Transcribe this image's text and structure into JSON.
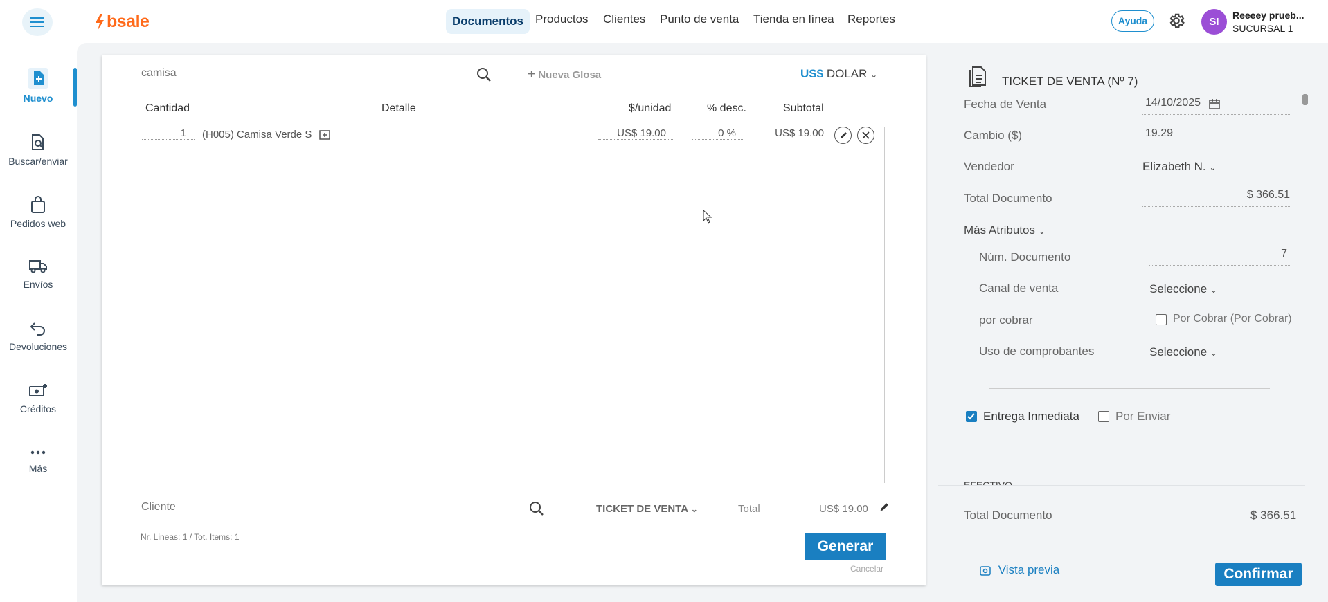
{
  "topbar": {
    "logo": "bsale",
    "nav": [
      "Documentos",
      "Productos",
      "Clientes",
      "Punto de venta",
      "Tienda en línea",
      "Reportes"
    ],
    "help": "Ayuda",
    "avatar_initials": "SI",
    "user_name": "Reeeey prueb...",
    "user_branch": "SUCURSAL 1"
  },
  "sidebar": {
    "items": [
      {
        "label": "Nuevo",
        "icon": "new-document-icon"
      },
      {
        "label": "Buscar/enviar",
        "icon": "search-document-icon"
      },
      {
        "label": "Pedidos web",
        "icon": "shopping-bag-icon"
      },
      {
        "label": "Envíos",
        "icon": "truck-icon"
      },
      {
        "label": "Devoluciones",
        "icon": "return-icon"
      },
      {
        "label": "Créditos",
        "icon": "money-plus-icon"
      },
      {
        "label": "Más",
        "icon": "more-dots-icon"
      }
    ]
  },
  "editor": {
    "search_value": "camisa",
    "new_gloss": "Nueva Glosa",
    "currency_symbol": "US$",
    "currency_name": "DOLAR",
    "headers": {
      "qty": "Cantidad",
      "detail": "Detalle",
      "unit": "$/unidad",
      "disc": "% desc.",
      "subtotal": "Subtotal"
    },
    "rows": [
      {
        "qty": "1",
        "detail": "(H005) Camisa Verde S",
        "unit": "US$ 19.00",
        "disc": "0 %",
        "subtotal": "US$ 19.00"
      }
    ],
    "client_placeholder": "Cliente",
    "doc_type": "TICKET DE VENTA",
    "total_label": "Total",
    "total_value": "US$ 19.00",
    "summary": "Nr. Lineas: 1 / Tot. Items: 1",
    "generate": "Generar",
    "cancel": "Cancelar"
  },
  "panel": {
    "title": "TICKET DE VENTA (Nº 7)",
    "fecha_label": "Fecha de Venta",
    "fecha_value": "14/10/2025",
    "cambio_label": "Cambio ($)",
    "cambio_value": "19.29",
    "vendedor_label": "Vendedor",
    "vendedor_value": "Elizabeth N.",
    "total_doc_label": "Total Documento",
    "total_doc_value": "$ 366.51",
    "mas_atributos": "Más Atributos",
    "num_doc_label": "Núm. Documento",
    "num_doc_value": "7",
    "canal_label": "Canal de venta",
    "canal_value": "Seleccione",
    "por_cobrar_label": "por cobrar",
    "por_cobrar_value": "Por Cobrar (Por Cobrar)",
    "uso_label": "Uso de comprobantes",
    "uso_value": "Seleccione",
    "entrega": "Entrega Inmediata",
    "por_enviar": "Por Enviar",
    "efectivo": "EFECTIVO",
    "total_doc_bottom_label": "Total Documento",
    "total_doc_bottom_value": "$ 366.51",
    "preview": "Vista previa",
    "confirm": "Confirmar"
  },
  "colors": {
    "accent": "#1a7fc1",
    "brand": "#ff6a1a",
    "avatar": "#9b4ed6"
  }
}
